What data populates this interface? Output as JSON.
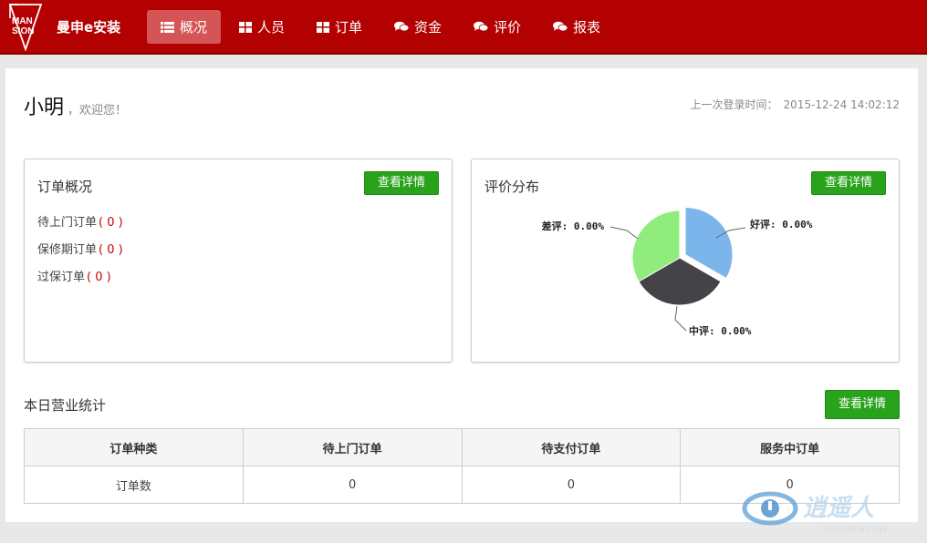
{
  "brand": {
    "name": "曼申e安装",
    "logo_text": "MANSION"
  },
  "nav": [
    {
      "label": "概况",
      "icon": "list-icon",
      "active": true
    },
    {
      "label": "人员",
      "icon": "grid-icon",
      "active": false
    },
    {
      "label": "订单",
      "icon": "grid-icon",
      "active": false
    },
    {
      "label": "资金",
      "icon": "chat-icon",
      "active": false
    },
    {
      "label": "评价",
      "icon": "chat-icon",
      "active": false
    },
    {
      "label": "报表",
      "icon": "chat-icon",
      "active": false
    }
  ],
  "greeting": {
    "name": "小明",
    "welcome": "，欢迎您！"
  },
  "last_login": {
    "label": "上一次登录时间：",
    "time": "2015-12-24 14:02:12"
  },
  "order_card": {
    "title": "订单概况",
    "button": "查看详情",
    "rows": [
      {
        "label": "待上门订单",
        "count": "( 0 )"
      },
      {
        "label": "保修期订单",
        "count": "( 0 )"
      },
      {
        "label": "过保订单",
        "count": "( 0 )"
      }
    ]
  },
  "rating_card": {
    "title": "评价分布",
    "button": "查看详情"
  },
  "chart_data": {
    "type": "pie",
    "slices": [
      {
        "name": "好评",
        "value": 0.0,
        "label": "好评: 0.00%",
        "color": "#7cb5ec"
      },
      {
        "name": "中评",
        "value": 0.0,
        "label": "中评: 0.00%",
        "color": "#434348"
      },
      {
        "name": "差评",
        "value": 0.0,
        "label": "差评: 0.00%",
        "color": "#90ed7d"
      }
    ]
  },
  "stats": {
    "title": "本日营业统计",
    "button": "查看详情",
    "headers": [
      "订单种类",
      "待上门订单",
      "待支付订单",
      "服务中订单"
    ],
    "rows": [
      [
        "订单数",
        "0",
        "0",
        "0"
      ]
    ]
  },
  "watermark": {
    "text": "逍遥人",
    "sub": "SUOYIREN.COM"
  },
  "colors": {
    "topbar": "#b30000",
    "active_nav": "#d45555",
    "button_green": "#2aa31c",
    "count_red": "#cc0000"
  }
}
